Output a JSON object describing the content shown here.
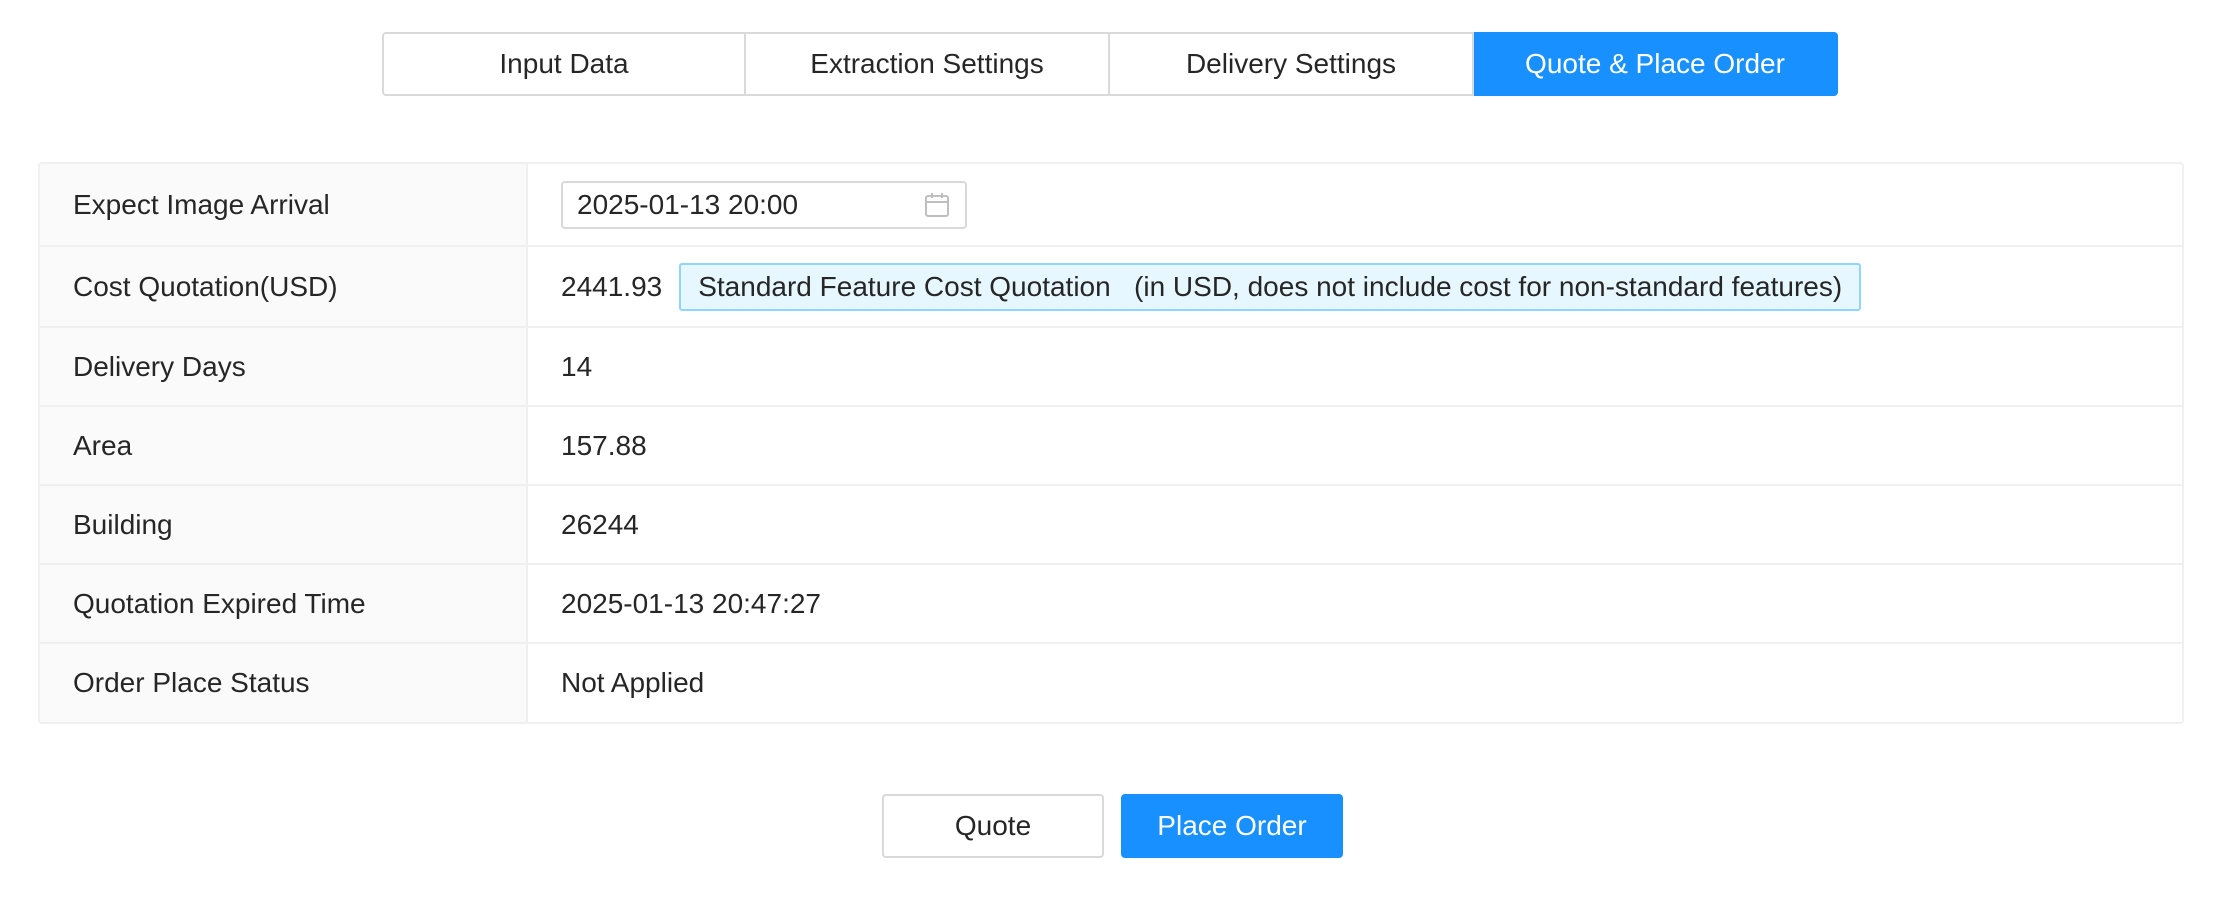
{
  "tabs": [
    {
      "label": "Input Data",
      "active": false
    },
    {
      "label": "Extraction Settings",
      "active": false
    },
    {
      "label": "Delivery Settings",
      "active": false
    },
    {
      "label": "Quote & Place Order",
      "active": true
    }
  ],
  "details": {
    "expect_image_arrival": {
      "label": "Expect Image Arrival",
      "value": "2025-01-13 20:00",
      "icon": "calendar-icon"
    },
    "cost_quotation": {
      "label": "Cost Quotation(USD)",
      "value": "2441.93",
      "tag": "Standard Feature Cost Quotation   (in USD, does not include cost for non-standard features)"
    },
    "delivery_days": {
      "label": "Delivery Days",
      "value": "14"
    },
    "area": {
      "label": "Area",
      "value": "157.88"
    },
    "building": {
      "label": "Building",
      "value": "26244"
    },
    "quotation_expired_time": {
      "label": "Quotation Expired Time",
      "value": "2025-01-13 20:47:27"
    },
    "order_place_status": {
      "label": "Order Place Status",
      "value": "Not Applied"
    }
  },
  "actions": {
    "quote_label": "Quote",
    "place_order_label": "Place Order"
  },
  "colors": {
    "primary": "#1890ff",
    "tag_background": "#e6f7ff",
    "tag_border": "#91d5ff",
    "border": "#d9d9d9",
    "label_background": "#fafafa"
  }
}
